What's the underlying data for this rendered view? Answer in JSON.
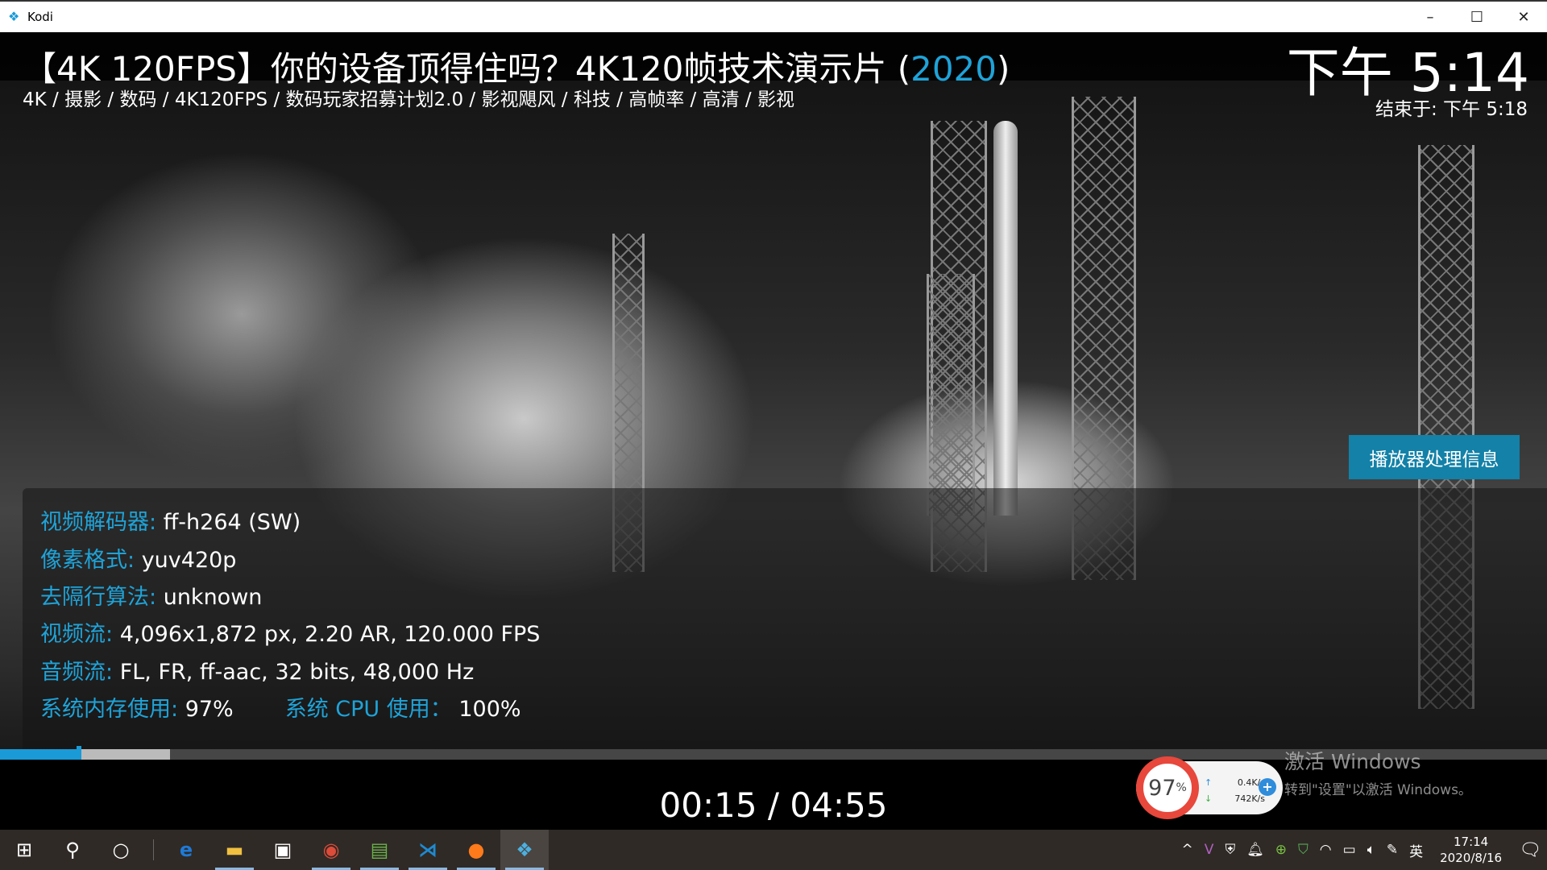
{
  "window": {
    "title": "Kodi",
    "controls": [
      "minimize",
      "maximize",
      "close"
    ]
  },
  "media": {
    "title_main": "【4K 120FPS】你的设备顶得住吗？4K120帧技术演示片 (",
    "year": "2020",
    "title_close": ")",
    "tags": "4K / 摄影 / 数码 / 4K120FPS / 数码玩家招募计划2.0 / 影视飓风 / 科技 / 高帧率 / 高清 / 影视"
  },
  "clock": {
    "time": "下午 5:14",
    "end_time": "结束于: 下午 5:18"
  },
  "info_button": "播放器处理信息",
  "info": {
    "decoder_label": "视频解码器:",
    "decoder": "ff-h264 (SW)",
    "pixel_label": "像素格式:",
    "pixel": "yuv420p",
    "deint_label": "去隔行算法:",
    "deint": "unknown",
    "video_label": "视频流:",
    "video": "4,096x1,872 px, 2.20 AR, 120.000 FPS",
    "audio_label": "音频流:",
    "audio": "FL, FR, ff-aac, 32 bits, 48,000 Hz",
    "mem_label": "系统内存使用:",
    "mem": "97%",
    "cpu_label": "系统 CPU 使用：",
    "cpu": "100%"
  },
  "playback": {
    "time": "00:15 / 04:55",
    "progress_percent": 5.1,
    "buffer_percent": 11
  },
  "watermark": {
    "line1": "激活 Windows",
    "line2": "转到\"设置\"以激活 Windows。"
  },
  "net_widget": {
    "memory": "97",
    "unit": "%",
    "up": "0.4K/s",
    "down": "742K/s"
  },
  "taskbar": {
    "apps": [
      "start",
      "search",
      "cortana",
      "edge",
      "file-explorer",
      "store",
      "chrome",
      "notepad",
      "vscode",
      "firefox",
      "kodi"
    ],
    "ime": "英",
    "time": "17:14",
    "date": "2020/8/16"
  },
  "colors": {
    "accent": "#1fa3d8",
    "button": "#1381a8"
  }
}
